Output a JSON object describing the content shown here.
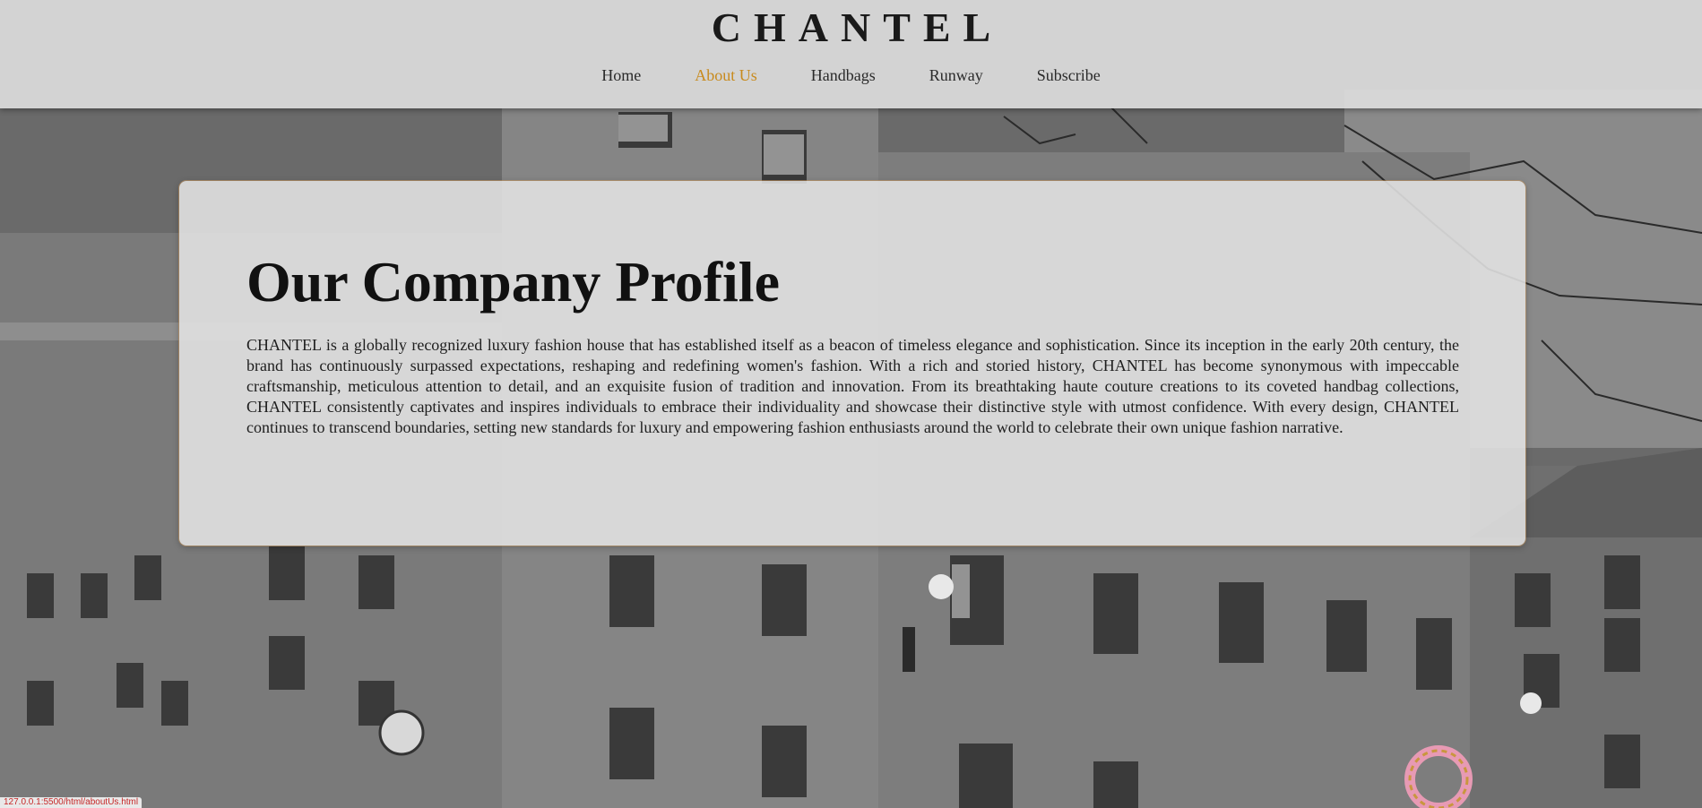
{
  "brand": "CHANTEL",
  "nav": {
    "items": [
      {
        "label": "Home"
      },
      {
        "label": "About Us"
      },
      {
        "label": "Handbags"
      },
      {
        "label": "Runway"
      },
      {
        "label": "Subscribe"
      }
    ],
    "active": "About Us"
  },
  "profile": {
    "title": "Our Company Profile",
    "body": "CHANTEL is a globally recognized luxury fashion house that has established itself as a beacon of timeless elegance and sophistication. Since its inception in the early 20th century, the brand has continuously surpassed expectations, reshaping and redefining women's fashion. With a rich and storied history, CHANTEL has become synonymous with impeccable craftsmanship, meticulous attention to detail, and an exquisite fusion of tradition and innovation. From its breathtaking haute couture creations to its coveted handbag collections, CHANTEL consistently captivates and inspires individuals to embrace their individuality and showcase their distinctive style with utmost confidence. With every design, CHANTEL continues to transcend boundaries, setting new standards for luxury and empowering fashion enthusiasts around the world to celebrate their own unique fashion narrative."
  },
  "status": {
    "url": "127.0.0.1:5500/html/aboutUs.html"
  },
  "colors": {
    "accent": "#c88a1c",
    "header_bg": "#dcdcdc",
    "text": "#1a1a1a"
  }
}
